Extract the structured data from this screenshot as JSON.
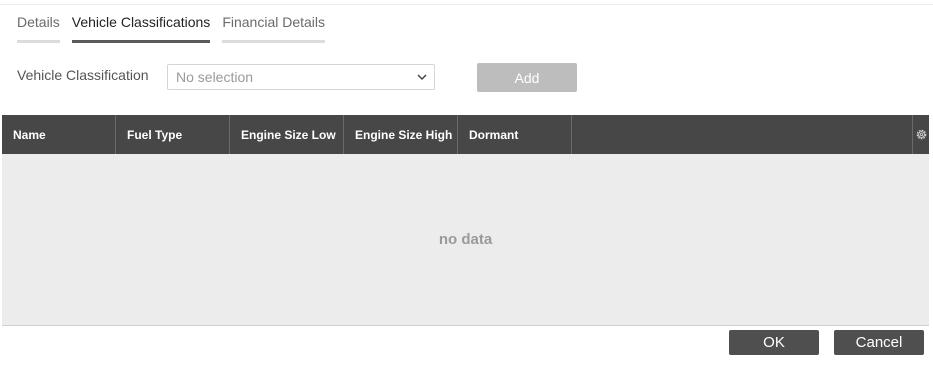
{
  "tabs": [
    {
      "label": "Details",
      "active": false
    },
    {
      "label": "Vehicle Classifications",
      "active": true
    },
    {
      "label": "Financial Details",
      "active": false
    }
  ],
  "form": {
    "label": "Vehicle Classification",
    "select_value": "No selection",
    "add_label": "Add"
  },
  "grid": {
    "columns": [
      "Name",
      "Fuel Type",
      "Engine Size Low",
      "Engine Size High",
      "Dormant"
    ],
    "empty_text": "no data",
    "settings_icon": "gear-icon"
  },
  "footer": {
    "ok_label": "OK",
    "cancel_label": "Cancel"
  },
  "colors": {
    "header_bg": "#474747",
    "grid_bg": "#ececec",
    "button_bg": "#4f4f4f",
    "disabled_button_bg": "#bdbdbd"
  }
}
